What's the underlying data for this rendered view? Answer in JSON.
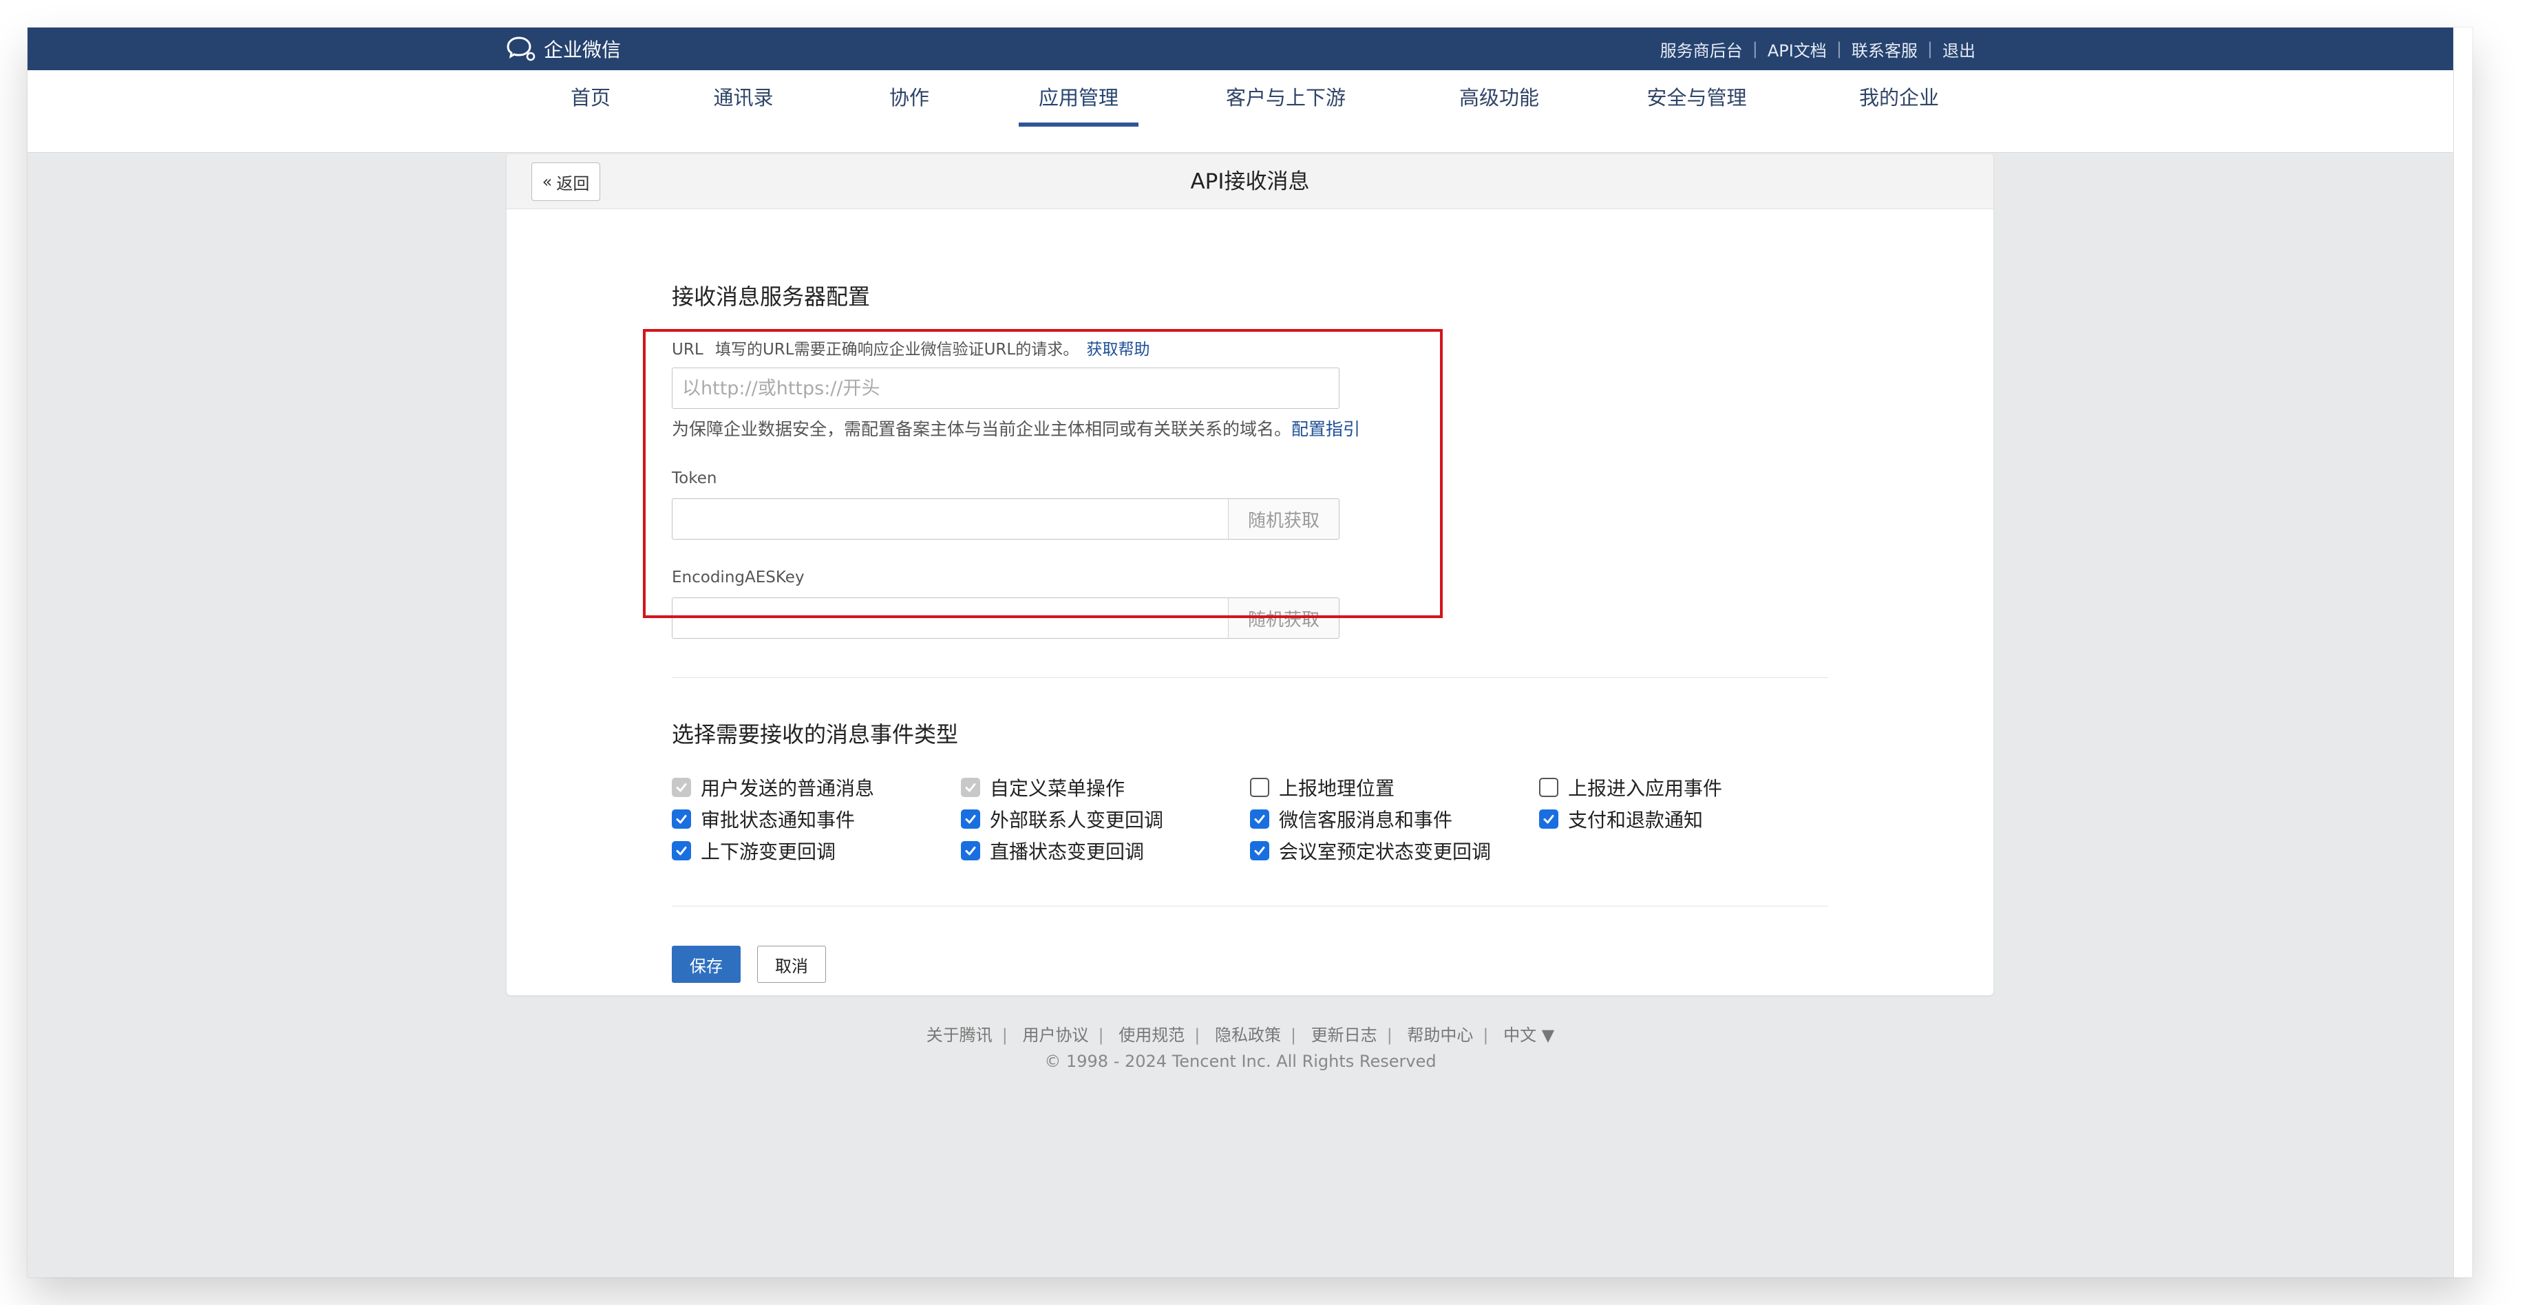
{
  "topbar": {
    "brand": "企业微信",
    "links": [
      "服务商后台",
      "API文档",
      "联系客服",
      "退出"
    ]
  },
  "nav": {
    "items": [
      "首页",
      "通讯录",
      "协作",
      "应用管理",
      "客户与上下游",
      "高级功能",
      "安全与管理",
      "我的企业"
    ],
    "active": "应用管理"
  },
  "card": {
    "back_label": "返回",
    "title": "API接收消息",
    "server_section_title": "接收消息服务器配置",
    "url_label": "URL",
    "url_hint": "填写的URL需要正确响应企业微信验证URL的请求。",
    "url_help": "获取帮助",
    "url_placeholder": "以http://或https://开头",
    "url_value": "",
    "security_note": "为保障企业数据安全，需配置备案主体与当前企业主体相同或有关联关系的域名。",
    "security_link": "配置指引",
    "token_label": "Token",
    "token_value": "",
    "aeskey_label": "EncodingAESKey",
    "aeskey_value": "",
    "random_label": "随机获取",
    "events_section_title": "选择需要接收的消息事件类型",
    "events": [
      {
        "label": "用户发送的普通消息",
        "state": "checked-disabled"
      },
      {
        "label": "自定义菜单操作",
        "state": "checked-disabled"
      },
      {
        "label": "上报地理位置",
        "state": "unchecked"
      },
      {
        "label": "上报进入应用事件",
        "state": "unchecked"
      },
      {
        "label": "审批状态通知事件",
        "state": "checked"
      },
      {
        "label": "外部联系人变更回调",
        "state": "checked"
      },
      {
        "label": "微信客服消息和事件",
        "state": "checked"
      },
      {
        "label": "支付和退款通知",
        "state": "checked"
      },
      {
        "label": "上下游变更回调",
        "state": "checked"
      },
      {
        "label": "直播状态变更回调",
        "state": "checked"
      },
      {
        "label": "会议室预定状态变更回调",
        "state": "checked"
      }
    ],
    "save_label": "保存",
    "cancel_label": "取消"
  },
  "footer": {
    "links": [
      "关于腾讯",
      "用户协议",
      "使用规范",
      "隐私政策",
      "更新日志",
      "帮助中心"
    ],
    "language": "中文 ▼",
    "copyright": "© 1998 - 2024 Tencent Inc. All Rights Reserved"
  },
  "colors": {
    "topbar": "#26436f",
    "accent": "#2f6fc0",
    "link": "#1d4e95",
    "highlight": "#d4141b",
    "checkbox": "#1a6fe0"
  }
}
